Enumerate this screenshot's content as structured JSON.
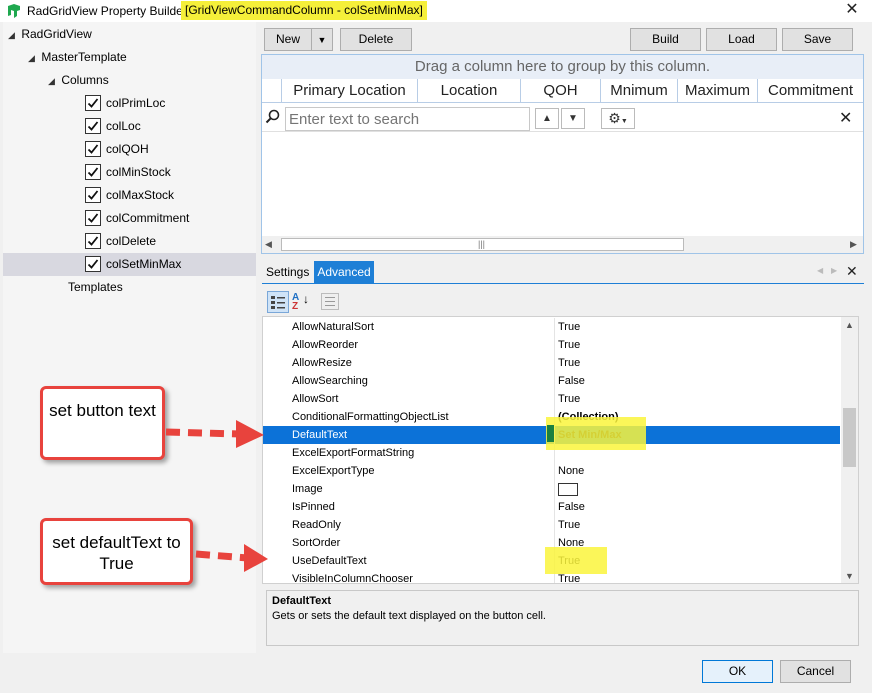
{
  "title": {
    "app": "RadGridView Property Builder - ",
    "context": "[GridViewCommandColumn - colSetMinMax]",
    "close_glyph": "✕"
  },
  "icons": {
    "app": "telerik-logo-icon",
    "close": "close-icon"
  },
  "tree": {
    "root": "RadGridView",
    "master": "MasterTemplate",
    "columns_label": "Columns",
    "columns": [
      "colPrimLoc",
      "colLoc",
      "colQOH",
      "colMinStock",
      "colMaxStock",
      "colCommitment",
      "colDelete",
      "colSetMinMax"
    ],
    "selected": "colSetMinMax",
    "templates": "Templates"
  },
  "toolbar": {
    "new": "New",
    "delete": "Delete",
    "build": "Build",
    "load": "Load",
    "save": "Save"
  },
  "grid": {
    "group_prompt": "Drag a column here to group by this column.",
    "headers": [
      "Primary Location",
      "Location",
      "QOH",
      "Mnimum",
      "Maximum",
      "Commitment"
    ],
    "search_placeholder": "Enter text to search"
  },
  "tabs": {
    "settings": "Settings",
    "advanced": "Advanced",
    "active": "Advanced"
  },
  "properties": [
    {
      "name": "AllowNaturalSort",
      "value": "True"
    },
    {
      "name": "AllowReorder",
      "value": "True"
    },
    {
      "name": "AllowResize",
      "value": "True"
    },
    {
      "name": "AllowSearching",
      "value": "False"
    },
    {
      "name": "AllowSort",
      "value": "True"
    },
    {
      "name": "ConditionalFormattingObjectList",
      "value": "(Collection)"
    },
    {
      "name": "DefaultText",
      "value": "Set Min/Max"
    },
    {
      "name": "ExcelExportFormatString",
      "value": ""
    },
    {
      "name": "ExcelExportType",
      "value": "None"
    },
    {
      "name": "Image",
      "value": ""
    },
    {
      "name": "IsPinned",
      "value": "False"
    },
    {
      "name": "ReadOnly",
      "value": "True"
    },
    {
      "name": "SortOrder",
      "value": "None"
    },
    {
      "name": "UseDefaultText",
      "value": "True"
    },
    {
      "name": "VisibleInColumnChooser",
      "value": "True"
    }
  ],
  "selected_property": "DefaultText",
  "description": {
    "title": "DefaultText",
    "text": "Gets or sets the default text displayed on the button cell."
  },
  "callouts": {
    "button_text": "set button text",
    "default_text": "set defaultText to True"
  },
  "dialog": {
    "ok": "OK",
    "cancel": "Cancel"
  },
  "colors": {
    "accent": "#1e7fd6",
    "highlight": "#f5ef3a",
    "callout_border": "#e8433d"
  }
}
